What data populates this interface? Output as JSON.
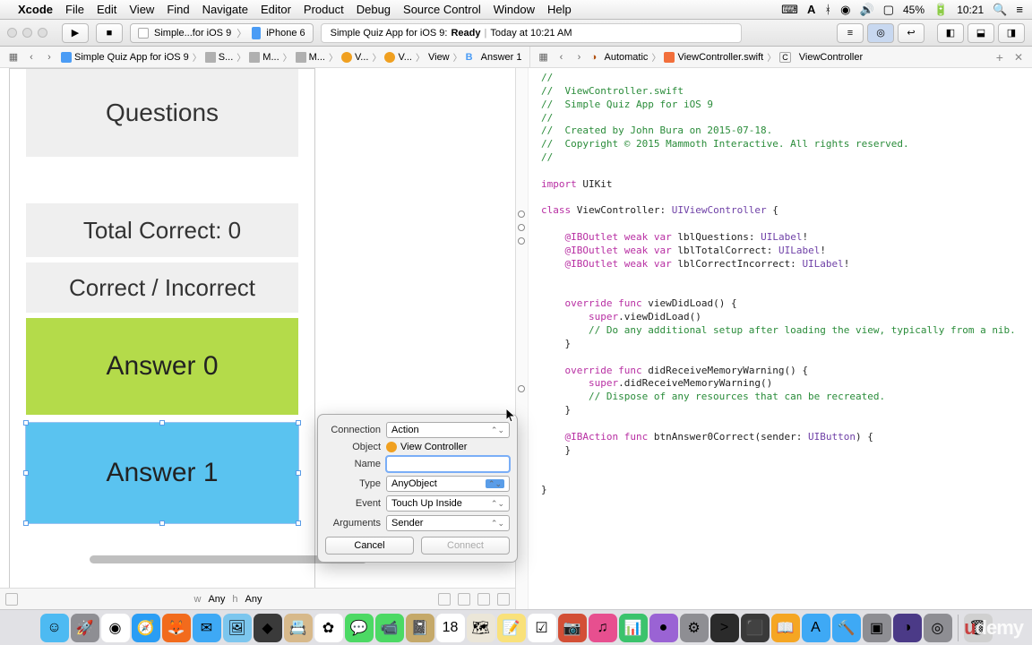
{
  "menubar": {
    "app": "Xcode",
    "items": [
      "File",
      "Edit",
      "View",
      "Find",
      "Navigate",
      "Editor",
      "Product",
      "Debug",
      "Source Control",
      "Window",
      "Help"
    ],
    "battery": "45%",
    "time": "10:21"
  },
  "toolbar": {
    "scheme_app": "Simple...for iOS 9",
    "scheme_device": "iPhone 6",
    "activity_project": "Simple Quiz App for iOS 9:",
    "activity_status": "Ready",
    "activity_time": "Today at 10:21 AM"
  },
  "pathbar_left": {
    "back": "‹",
    "fwd": "›",
    "project": "Simple Quiz App for iOS 9",
    "folder1": "S...",
    "folder2": "M...",
    "folder3": "M...",
    "vc1": "V...",
    "vc2": "V...",
    "view": "View",
    "selected": "Answer 1"
  },
  "pathbar_right": {
    "automatic": "Automatic",
    "file": "ViewController.swift",
    "class": "ViewController"
  },
  "ib": {
    "questions": "Questions",
    "total_correct": "Total Correct: 0",
    "correct_incorrect": "Correct / Incorrect",
    "answer0": "Answer 0",
    "answer1": "Answer 1",
    "w_label": "w",
    "w_value": "Any",
    "h_label": "h",
    "h_value": "Any"
  },
  "popover": {
    "connection_label": "Connection",
    "connection_value": "Action",
    "object_label": "Object",
    "object_value": "View Controller",
    "name_label": "Name",
    "name_value": "",
    "type_label": "Type",
    "type_value": "AnyObject",
    "event_label": "Event",
    "event_value": "Touch Up Inside",
    "arguments_label": "Arguments",
    "arguments_value": "Sender",
    "cancel": "Cancel",
    "connect": "Connect"
  },
  "code": {
    "lines": [
      {
        "t": "cmt",
        "s": "//"
      },
      {
        "t": "cmt",
        "s": "//  ViewController.swift"
      },
      {
        "t": "cmt",
        "s": "//  Simple Quiz App for iOS 9"
      },
      {
        "t": "cmt",
        "s": "//"
      },
      {
        "t": "cmt",
        "s": "//  Created by John Bura on 2015-07-18."
      },
      {
        "t": "cmt",
        "s": "//  Copyright © 2015 Mammoth Interactive. All rights reserved."
      },
      {
        "t": "cmt",
        "s": "//"
      },
      {
        "t": "",
        "s": ""
      },
      {
        "t": "mix",
        "parts": [
          {
            "c": "kw",
            "s": "import"
          },
          {
            "c": "",
            "s": " UIKit"
          }
        ]
      },
      {
        "t": "",
        "s": ""
      },
      {
        "t": "mix",
        "parts": [
          {
            "c": "kw",
            "s": "class"
          },
          {
            "c": "",
            "s": " ViewController: "
          },
          {
            "c": "type",
            "s": "UIViewController"
          },
          {
            "c": "",
            "s": " {"
          }
        ]
      },
      {
        "t": "",
        "s": ""
      },
      {
        "t": "mix",
        "indent": 1,
        "parts": [
          {
            "c": "kw",
            "s": "@IBOutlet"
          },
          {
            "c": "",
            "s": " "
          },
          {
            "c": "kw",
            "s": "weak"
          },
          {
            "c": "",
            "s": " "
          },
          {
            "c": "kw",
            "s": "var"
          },
          {
            "c": "",
            "s": " lblQuestions: "
          },
          {
            "c": "type",
            "s": "UILabel"
          },
          {
            "c": "",
            "s": "!"
          }
        ]
      },
      {
        "t": "mix",
        "indent": 1,
        "parts": [
          {
            "c": "kw",
            "s": "@IBOutlet"
          },
          {
            "c": "",
            "s": " "
          },
          {
            "c": "kw",
            "s": "weak"
          },
          {
            "c": "",
            "s": " "
          },
          {
            "c": "kw",
            "s": "var"
          },
          {
            "c": "",
            "s": " lblTotalCorrect: "
          },
          {
            "c": "type",
            "s": "UILabel"
          },
          {
            "c": "",
            "s": "!"
          }
        ]
      },
      {
        "t": "mix",
        "indent": 1,
        "parts": [
          {
            "c": "kw",
            "s": "@IBOutlet"
          },
          {
            "c": "",
            "s": " "
          },
          {
            "c": "kw",
            "s": "weak"
          },
          {
            "c": "",
            "s": " "
          },
          {
            "c": "kw",
            "s": "var"
          },
          {
            "c": "",
            "s": " lblCorrectIncorrect: "
          },
          {
            "c": "type",
            "s": "UILabel"
          },
          {
            "c": "",
            "s": "!"
          }
        ]
      },
      {
        "t": "",
        "s": ""
      },
      {
        "t": "",
        "s": ""
      },
      {
        "t": "mix",
        "indent": 1,
        "parts": [
          {
            "c": "kw",
            "s": "override"
          },
          {
            "c": "",
            "s": " "
          },
          {
            "c": "kw",
            "s": "func"
          },
          {
            "c": "",
            "s": " viewDidLoad() {"
          }
        ]
      },
      {
        "t": "mix",
        "indent": 2,
        "parts": [
          {
            "c": "kw",
            "s": "super"
          },
          {
            "c": "",
            "s": ".viewDidLoad()"
          }
        ]
      },
      {
        "t": "cmt",
        "indent": 2,
        "s": "// Do any additional setup after loading the view, typically from a nib."
      },
      {
        "t": "",
        "indent": 1,
        "s": "}"
      },
      {
        "t": "",
        "s": ""
      },
      {
        "t": "mix",
        "indent": 1,
        "parts": [
          {
            "c": "kw",
            "s": "override"
          },
          {
            "c": "",
            "s": " "
          },
          {
            "c": "kw",
            "s": "func"
          },
          {
            "c": "",
            "s": " didReceiveMemoryWarning() {"
          }
        ]
      },
      {
        "t": "mix",
        "indent": 2,
        "parts": [
          {
            "c": "kw",
            "s": "super"
          },
          {
            "c": "",
            "s": ".didReceiveMemoryWarning()"
          }
        ]
      },
      {
        "t": "cmt",
        "indent": 2,
        "s": "// Dispose of any resources that can be recreated."
      },
      {
        "t": "",
        "indent": 1,
        "s": "}"
      },
      {
        "t": "",
        "s": ""
      },
      {
        "t": "mix",
        "indent": 1,
        "parts": [
          {
            "c": "kw",
            "s": "@IBAction"
          },
          {
            "c": "",
            "s": " "
          },
          {
            "c": "kw",
            "s": "func"
          },
          {
            "c": "",
            "s": " btnAnswer0Correct(sender: "
          },
          {
            "c": "type",
            "s": "UIButton"
          },
          {
            "c": "",
            "s": ") {"
          }
        ]
      },
      {
        "t": "",
        "indent": 1,
        "s": "}"
      },
      {
        "t": "",
        "s": ""
      },
      {
        "t": "",
        "s": ""
      },
      {
        "t": "",
        "s": "}"
      }
    ]
  },
  "watermark": "demy",
  "dock": {
    "apps": [
      {
        "n": "finder",
        "bg": "#4dbaf2",
        "g": "☺"
      },
      {
        "n": "launchpad",
        "bg": "#8e8e93",
        "g": "🚀"
      },
      {
        "n": "chrome",
        "bg": "#fff",
        "g": "◉"
      },
      {
        "n": "safari",
        "bg": "#2a9df4",
        "g": "🧭"
      },
      {
        "n": "firefox",
        "bg": "#f26b1d",
        "g": "🦊"
      },
      {
        "n": "mail",
        "bg": "#3ea9f5",
        "g": "✉"
      },
      {
        "n": "preview",
        "bg": "#7cc6ee",
        "g": "🖼"
      },
      {
        "n": "unity",
        "bg": "#3a3a3a",
        "g": "◆"
      },
      {
        "n": "contacts",
        "bg": "#d7b98b",
        "g": "📇"
      },
      {
        "n": "photos",
        "bg": "#fff",
        "g": "✿"
      },
      {
        "n": "messages",
        "bg": "#4cd964",
        "g": "💬"
      },
      {
        "n": "facetime",
        "bg": "#4cd964",
        "g": "📹"
      },
      {
        "n": "maybe",
        "bg": "#c5a96a",
        "g": "📓"
      },
      {
        "n": "calendar",
        "bg": "#fff",
        "g": "18"
      },
      {
        "n": "maps",
        "bg": "#ebe6d8",
        "g": "🗺"
      },
      {
        "n": "notes",
        "bg": "#f9e17a",
        "g": "📝"
      },
      {
        "n": "reminders",
        "bg": "#fff",
        "g": "☑"
      },
      {
        "n": "photobooth",
        "bg": "#d34f36",
        "g": "📷"
      },
      {
        "n": "itunes",
        "bg": "#e74f8f",
        "g": "♫"
      },
      {
        "n": "numbers",
        "bg": "#3bc36c",
        "g": "📊"
      },
      {
        "n": "game",
        "bg": "#9a63d4",
        "g": "●"
      },
      {
        "n": "systemprefs",
        "bg": "#8e8e93",
        "g": "⚙"
      },
      {
        "n": "terminal",
        "bg": "#2b2b2b",
        "g": ">"
      },
      {
        "n": "jetbrains",
        "bg": "#3a3a3a",
        "g": "⬛"
      },
      {
        "n": "ibooks",
        "bg": "#f5a623",
        "g": "📖"
      },
      {
        "n": "appstore",
        "bg": "#3ea9f5",
        "g": "A"
      },
      {
        "n": "xcode",
        "bg": "#3ea9f5",
        "g": "🔨"
      },
      {
        "n": "misc1",
        "bg": "#8e8e93",
        "g": "▣"
      },
      {
        "n": "eclipse",
        "bg": "#4b3a87",
        "g": "◑"
      },
      {
        "n": "misc2",
        "bg": "#8e8e93",
        "g": "◎"
      },
      {
        "n": "trash",
        "bg": "#d0d0d0",
        "g": "🗑"
      }
    ]
  }
}
